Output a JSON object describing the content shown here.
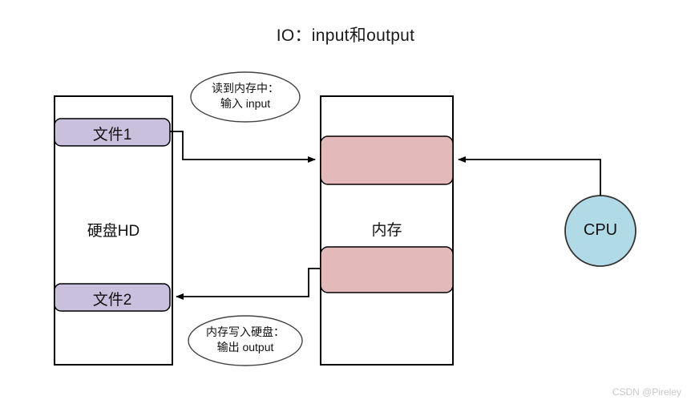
{
  "title": "IO：input和output",
  "disk": {
    "label": "硬盘HD",
    "files": [
      {
        "name": "文件1"
      },
      {
        "name": "文件2"
      }
    ],
    "fill": "#c9c0dd",
    "stroke": "#000000"
  },
  "memory": {
    "label": "内存",
    "blocks": [
      {
        "name": "memory-block-top"
      },
      {
        "name": "memory-block-bottom"
      }
    ],
    "fill": "#e3b9b9",
    "stroke": "#000000"
  },
  "cpu": {
    "label": "CPU",
    "fill": "#b1dae7",
    "stroke": "#333333"
  },
  "callouts": {
    "input": {
      "line1": "读到内存中：",
      "line2": "输入 input"
    },
    "output": {
      "line1": "内存写入硬盘：",
      "line2": "输出 output"
    }
  },
  "arrows": {
    "input_flow": "文件1 → 内存",
    "output_flow": "内存 → 文件2",
    "cpu_flow": "CPU → 内存"
  },
  "watermark": "CSDN @Pireley"
}
